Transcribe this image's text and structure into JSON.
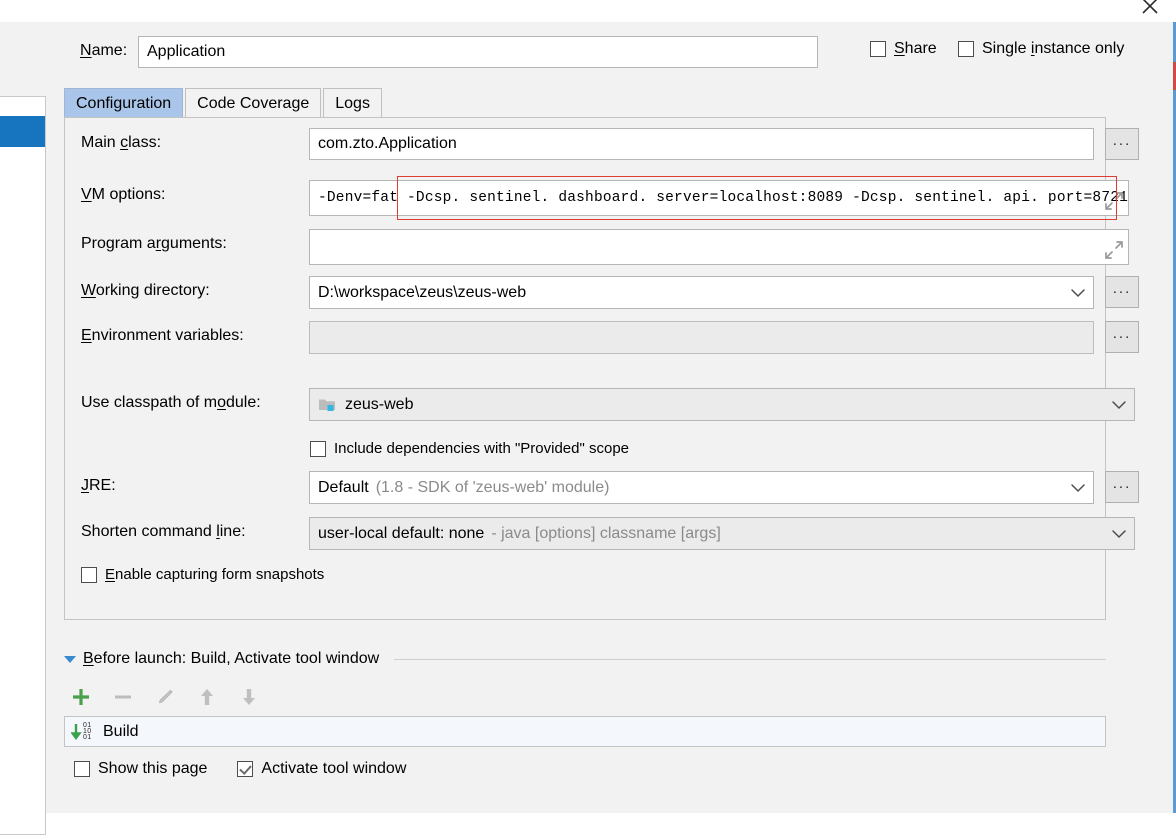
{
  "window": {
    "close_icon": "close-icon"
  },
  "name_row": {
    "label": "Name:",
    "label_mnemonic": "N",
    "value": "Application",
    "share": {
      "label": "Share",
      "mnemonic": "S",
      "checked": false
    },
    "single_instance": {
      "label": "Single instance only",
      "mnemonic": "i",
      "checked": false
    }
  },
  "tabs": [
    {
      "label": "Configuration",
      "active": true
    },
    {
      "label": "Code Coverage",
      "active": false
    },
    {
      "label": "Logs",
      "active": false
    }
  ],
  "fields": {
    "main_class": {
      "label": "Main class:",
      "label_pre": "Main ",
      "label_mnemonic": "c",
      "label_post": "lass:",
      "value": "com.zto.Application",
      "browse_label": "..."
    },
    "vm_options": {
      "label_pre": "",
      "label_mnemonic": "V",
      "label_post": "M options:",
      "value": "-Denv=fat -Dcsp. sentinel. dashboard. server=localhost:8089  -Dcsp. sentinel. api. port=8721",
      "value_prefix": "-Denv=fat",
      "value_highlighted": "-Dcsp. sentinel. dashboard. server=localhost:8089  -Dcsp. sentinel. api. port=8721",
      "expand_icon": "expand-arrows-icon",
      "highlight_color": "#e03c31"
    },
    "program_arguments": {
      "label_pre": "Program a",
      "label_mnemonic": "r",
      "label_post": "guments:",
      "value": "",
      "expand_icon": "expand-arrows-icon"
    },
    "working_directory": {
      "label_pre": "",
      "label_mnemonic": "W",
      "label_post": "orking directory:",
      "value": "D:\\workspace\\zeus\\zeus-web",
      "browse_label": "...",
      "dropdown_icon": "chevron-down-icon"
    },
    "environment_variables": {
      "label_pre": "",
      "label_mnemonic": "E",
      "label_post": "nvironment variables:",
      "value": "",
      "browse_label": "...",
      "disabled": true
    },
    "use_classpath_of_module": {
      "label_pre": "Use classpath of m",
      "label_mnemonic": "o",
      "label_post": "dule:",
      "value": "zeus-web",
      "item_icon": "module-folder-icon",
      "dropdown_icon": "chevron-down-icon"
    },
    "include_provided": {
      "label": "Include dependencies with \"Provided\" scope",
      "checked": false
    },
    "jre": {
      "label_pre": "",
      "label_mnemonic": "J",
      "label_post": "RE:",
      "value": "Default",
      "value_detail": "(1.8 - SDK of 'zeus-web' module)",
      "browse_label": "...",
      "dropdown_icon": "chevron-down-icon"
    },
    "shorten_command_line": {
      "label_pre": "Shorten command ",
      "label_mnemonic": "l",
      "label_post": "ine:",
      "value": "user-local default: none",
      "value_detail": "- java [options] classname [args]",
      "dropdown_icon": "chevron-down-icon"
    },
    "enable_form_snapshots": {
      "label_pre": "",
      "label_mnemonic": "E",
      "label_post": "nable capturing form snapshots",
      "checked": false
    }
  },
  "before_launch": {
    "expander_icon": "triangle-down-icon",
    "title_pre": "",
    "title_mnemonic": "B",
    "title_post": "efore launch: Build, Activate tool window",
    "toolbar": [
      {
        "name": "add-button",
        "glyph": "+",
        "enabled": true
      },
      {
        "name": "remove-button",
        "glyph": "−",
        "enabled": false
      },
      {
        "name": "edit-button",
        "glyph": "pencil-icon",
        "enabled": false
      },
      {
        "name": "move-up-button",
        "glyph": "arrow-up-icon",
        "enabled": false
      },
      {
        "name": "move-down-button",
        "glyph": "arrow-down-icon",
        "enabled": false
      }
    ],
    "items": [
      {
        "label": "Build",
        "icon": "build-icon"
      }
    ],
    "show_this_page": {
      "label": "Show this page",
      "checked": false
    },
    "activate_tool_window": {
      "label": "Activate tool window",
      "checked": true
    }
  },
  "colors": {
    "accent_blue": "#1774bf",
    "tab_active": "#a9c6ea",
    "highlight_red": "#e03c31",
    "add_green": "#4aa14a",
    "panel_bg": "#f2f2f2"
  }
}
